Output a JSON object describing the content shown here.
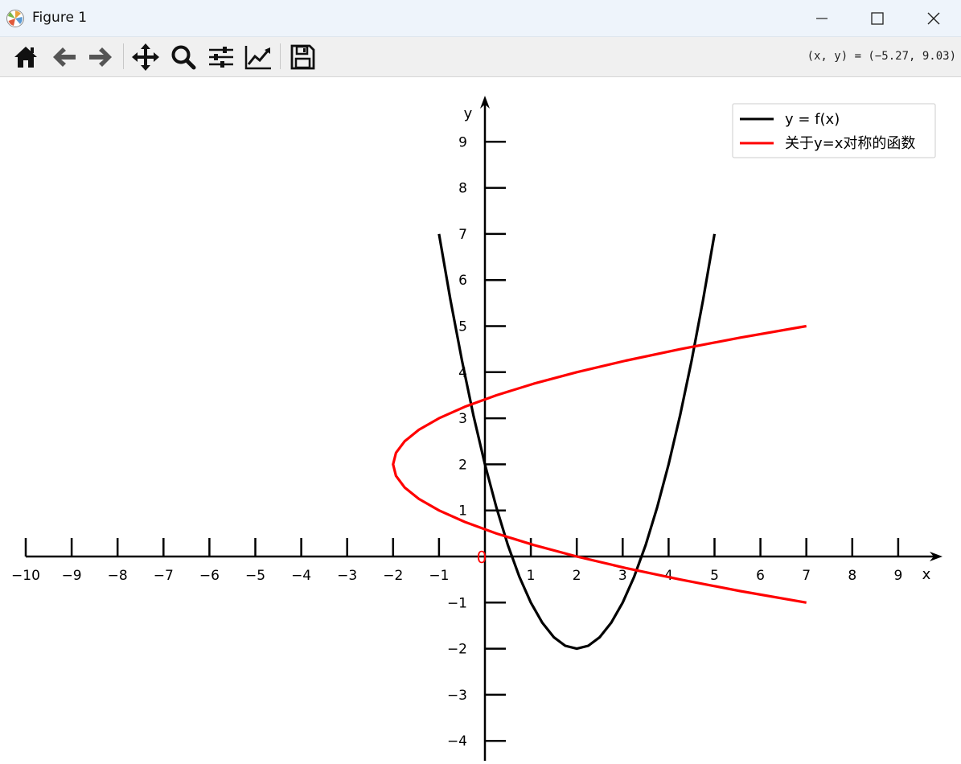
{
  "window": {
    "title": "Figure 1",
    "minimize_symbol": "—",
    "close_symbol": "✕"
  },
  "toolbar": {
    "tools": [
      "home-icon",
      "back-arrow-icon",
      "forward-arrow-icon",
      "pan-icon",
      "zoom-icon",
      "configure-subplots-icon",
      "edit-axis-icon",
      "save-icon"
    ],
    "coordinate_readout": "(x, y) = (−5.27, 9.03)"
  },
  "chart_data": {
    "type": "line",
    "xlabel": "x",
    "ylabel": "y",
    "xlim": [
      -10,
      10
    ],
    "ylim": [
      -4.5,
      10
    ],
    "x_ticks": [
      -10,
      -9,
      -8,
      -7,
      -6,
      -5,
      -4,
      -3,
      -2,
      -1,
      1,
      2,
      3,
      4,
      5,
      6,
      7,
      8,
      9
    ],
    "y_ticks": [
      -4,
      -3,
      -2,
      -1,
      1,
      2,
      3,
      4,
      5,
      6,
      7,
      8,
      9
    ],
    "origin_label": "0",
    "legend_position": "top-right",
    "grid": false,
    "series": [
      {
        "name": "y = f(x)",
        "color": "#000000",
        "x": [
          -1,
          -0.75,
          -0.5,
          -0.25,
          0,
          0.25,
          0.5,
          0.75,
          1,
          1.25,
          1.5,
          1.75,
          2,
          2.25,
          2.5,
          2.75,
          3,
          3.25,
          3.5,
          3.75,
          4,
          4.25,
          4.5,
          4.75,
          5
        ],
        "y": [
          7,
          5.5625,
          4.25,
          3.0625,
          2,
          1.0625,
          0.25,
          -0.4375,
          -1,
          -1.4375,
          -1.75,
          -1.9375,
          -2,
          -1.9375,
          -1.75,
          -1.4375,
          -1,
          -0.4375,
          0.25,
          1.0625,
          2,
          3.0625,
          4.25,
          5.5625,
          7
        ]
      },
      {
        "name": "关于y=x对称的函数",
        "color": "#ff0000",
        "x": [
          7,
          5.5625,
          4.25,
          3.0625,
          2,
          1.0625,
          0.25,
          -0.4375,
          -1,
          -1.4375,
          -1.75,
          -1.9375,
          -2,
          -1.9375,
          -1.75,
          -1.4375,
          -1,
          -0.4375,
          0.25,
          1.0625,
          2,
          3.0625,
          4.25,
          5.5625,
          7
        ],
        "y": [
          -1,
          -0.75,
          -0.5,
          -0.25,
          0,
          0.25,
          0.5,
          0.75,
          1,
          1.25,
          1.5,
          1.75,
          2,
          2.25,
          2.5,
          2.75,
          3,
          3.25,
          3.5,
          3.75,
          4,
          4.25,
          4.5,
          4.75,
          5
        ]
      }
    ]
  }
}
